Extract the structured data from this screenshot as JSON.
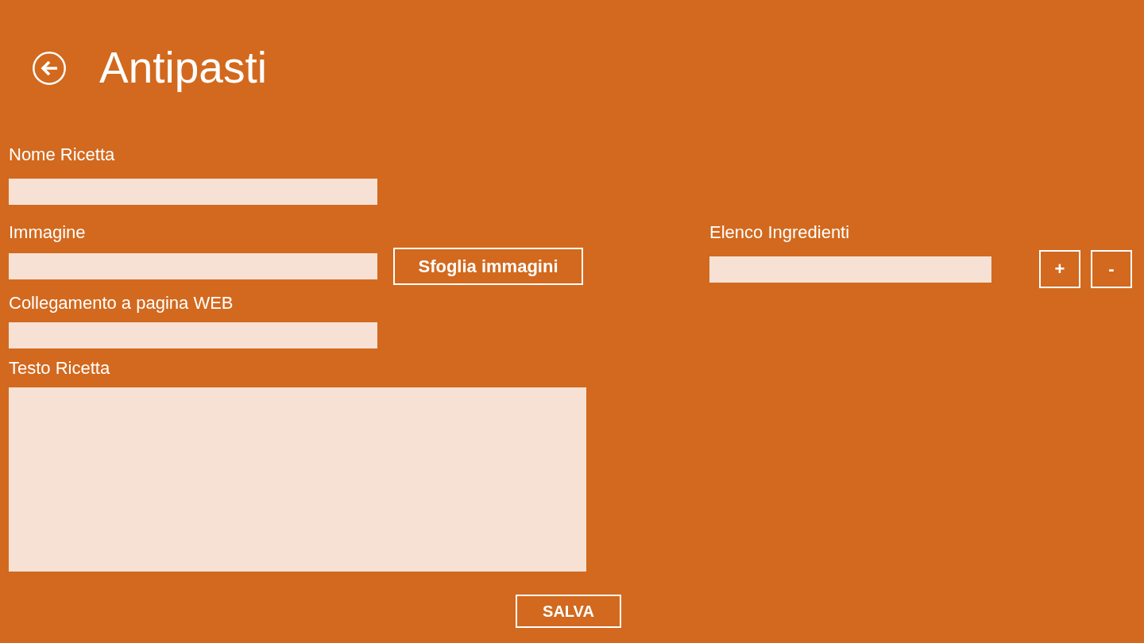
{
  "header": {
    "title": "Antipasti"
  },
  "form": {
    "fields": [
      {
        "label": "Nome Ricetta",
        "kind": "text"
      },
      {
        "label": "Immagine",
        "kind": "text",
        "button": "Sfoglia immagini"
      },
      {
        "label": "Collegamento a pagina WEB",
        "kind": "text"
      },
      {
        "label": "Testo Ricetta",
        "kind": "multiline"
      }
    ],
    "save_button": "SALVA"
  },
  "ingredients": {
    "label": "Elenco Ingredienti",
    "add_button": "+",
    "remove_button": "-"
  }
}
